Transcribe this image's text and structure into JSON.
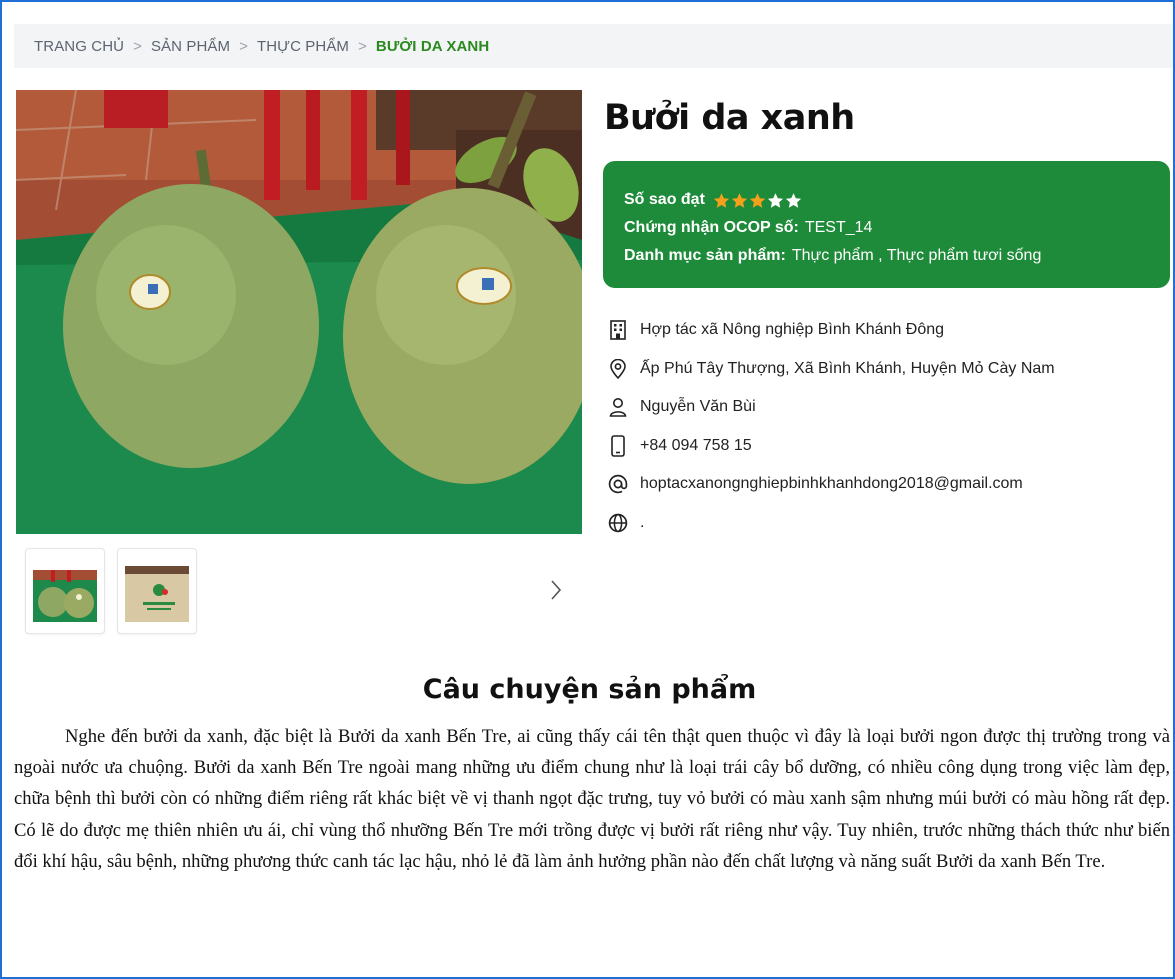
{
  "breadcrumb": {
    "items": [
      {
        "label": "TRANG CHỦ"
      },
      {
        "label": "SẢN PHẨM"
      },
      {
        "label": "THỰC PHẨM"
      },
      {
        "label": "BƯỞI DA XANH"
      }
    ]
  },
  "product": {
    "title": "Bưởi da xanh",
    "rating_label": "Số sao đạt",
    "rating_value": 3,
    "rating_max": 5,
    "certificate_label": "Chứng nhận OCOP số:",
    "certificate_value": "TEST_14",
    "category_label": "Danh mục sản phẩm:",
    "category_value": "Thực phẩm , Thực phẩm tươi sống",
    "card_color": "#1e8b3b",
    "star_filled_color": "#f5a01a",
    "star_empty_color": "#ffffff"
  },
  "contact": {
    "organization": {
      "icon": "building-icon",
      "text": "Hợp tác xã Nông nghiệp Bình Khánh Đông"
    },
    "address": {
      "icon": "location-pin-icon",
      "text": "Ấp Phú Tây Thượng, Xã Bình Khánh, Huyện Mỏ Cày Nam"
    },
    "person": {
      "icon": "person-icon",
      "text": "Nguyễn Văn Bùi"
    },
    "phone": {
      "icon": "phone-icon",
      "text": "+84 094 758 15"
    },
    "email": {
      "icon": "at-sign-icon",
      "text": "hoptacxanongnghiepbinhkhanhdong2018@gmail.com"
    },
    "website": {
      "icon": "globe-icon",
      "text": "."
    }
  },
  "gallery": {
    "thumbnail_count": 2,
    "next_icon": "chevron-right-icon"
  },
  "story": {
    "title": "Câu chuyện sản phẩm",
    "body": "Nghe đến bưởi da xanh, đặc biệt là Bưởi da xanh Bến Tre, ai cũng thấy cái tên thật quen thuộc vì đây là loại bưởi ngon được thị trường trong và ngoài nước ưa chuộng. Bưởi da xanh Bến Tre ngoài mang những ưu điểm chung như là loại trái cây bổ dưỡng, có nhiều công dụng trong việc làm đẹp, chữa bệnh thì bưởi còn có những điểm riêng rất khác biệt về vị thanh ngọt đặc trưng, tuy vỏ bưởi có màu xanh sậm nhưng múi bưởi có màu hồng rất đẹp. Có lẽ do được mẹ thiên nhiên ưu ái, chỉ vùng thổ nhưỡng Bến Tre mới trồng được vị bưởi rất riêng như vậy. Tuy nhiên, trước những thách thức như biến đổi khí hậu, sâu bệnh, những phương thức canh tác lạc hậu, nhỏ lẻ đã làm ảnh hưởng phần nào đến chất lượng và năng suất Bưởi da xanh Bến Tre."
  }
}
